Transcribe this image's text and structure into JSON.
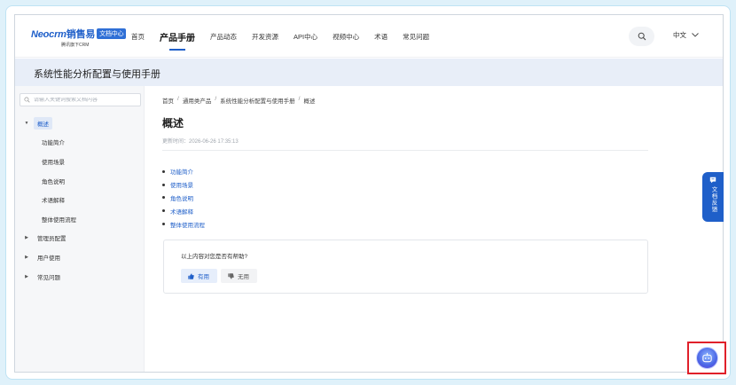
{
  "header": {
    "logo": {
      "brand_en": "Neocrm",
      "brand_cn": "销售易",
      "badge": "文档中心",
      "sub": "腾讯旗下CRM"
    },
    "nav": [
      {
        "label": "首页",
        "active": false
      },
      {
        "label": "产品手册",
        "active": true
      },
      {
        "label": "产品动态",
        "active": false
      },
      {
        "label": "开发资源",
        "active": false
      },
      {
        "label": "API中心",
        "active": false
      },
      {
        "label": "视频中心",
        "active": false
      },
      {
        "label": "术语",
        "active": false
      },
      {
        "label": "常见问题",
        "active": false
      }
    ],
    "search_icon": "search-icon",
    "language": "中文"
  },
  "band": {
    "title": "系统性能分析配置与使用手册"
  },
  "sidebar": {
    "search_placeholder": "请输入关键词搜索文档内容",
    "tree": [
      {
        "label": "概述",
        "level": 0,
        "expanded": true,
        "selected": true
      },
      {
        "label": "功能简介",
        "level": 1
      },
      {
        "label": "使用场景",
        "level": 1
      },
      {
        "label": "角色说明",
        "level": 1
      },
      {
        "label": "术语解释",
        "level": 1
      },
      {
        "label": "整体使用流程",
        "level": 1
      },
      {
        "label": "管理员配置",
        "level": 0,
        "expanded": false
      },
      {
        "label": "用户使用",
        "level": 0,
        "expanded": false
      },
      {
        "label": "常见问题",
        "level": 0,
        "expanded": false
      }
    ]
  },
  "main": {
    "breadcrumb": [
      "首页",
      "通用类产品",
      "系统性能分析配置与使用手册",
      "概述"
    ],
    "title": "概述",
    "updated": "更新时间：2026-06-26 17:35:13",
    "toc": [
      "功能简介",
      "使用场景",
      "角色说明",
      "术语解释",
      "整体使用流程"
    ],
    "feedback": {
      "question": "以上内容对您是否有帮助?",
      "yes": "有用",
      "no": "无用"
    }
  },
  "side_tab": {
    "label": "文档反馈"
  },
  "colors": {
    "accent": "#1f5fc9",
    "band": "#e8eef8",
    "highlight_border": "#e0202a"
  }
}
